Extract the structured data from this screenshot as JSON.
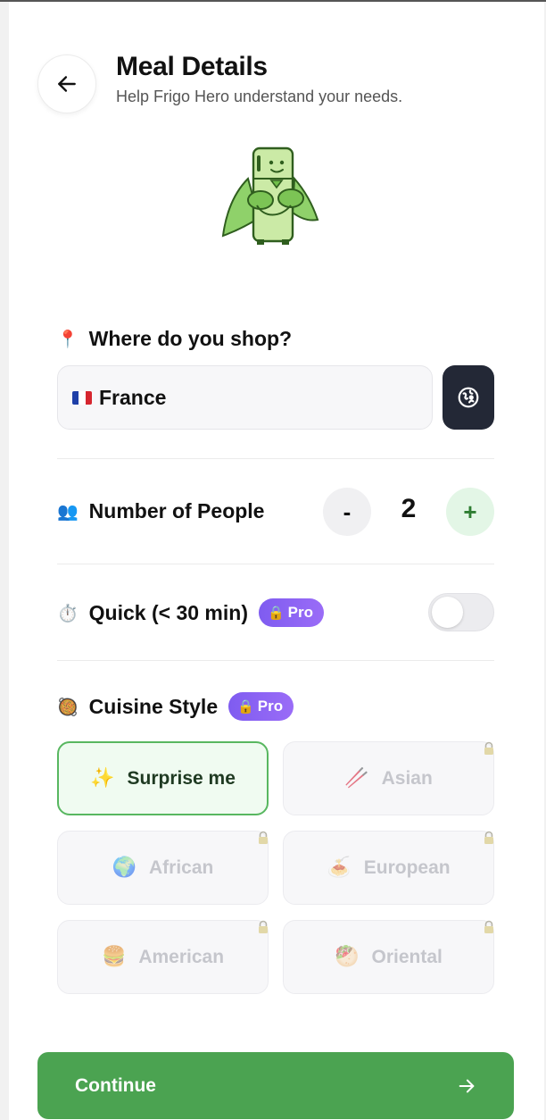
{
  "header": {
    "title": "Meal Details",
    "subtitle": "Help Frigo Hero understand your needs.",
    "back_icon": "arrow-left-icon"
  },
  "shop": {
    "label": "Where do you shop?",
    "icon": "📍",
    "country_flag": "france-flag-icon",
    "country_value": "France",
    "locate_icon": "globe-locate-icon"
  },
  "people": {
    "label": "Number of People",
    "icon": "👥",
    "minus_label": "-",
    "count": "2",
    "plus_label": "+"
  },
  "quick": {
    "label": "Quick (< 30 min)",
    "icon": "⏱️",
    "pro_label": "Pro",
    "pro_icon": "🔒",
    "enabled": false
  },
  "cuisine": {
    "label": "Cuisine Style",
    "icon": "🥘",
    "pro_label": "Pro",
    "pro_icon": "🔒",
    "options": [
      {
        "label": "Surprise me",
        "icon": "✨",
        "selected": true,
        "locked": false
      },
      {
        "label": "Asian",
        "icon": "🥢",
        "selected": false,
        "locked": true
      },
      {
        "label": "African",
        "icon": "🌍",
        "selected": false,
        "locked": true
      },
      {
        "label": "European",
        "icon": "🍝",
        "selected": false,
        "locked": true
      },
      {
        "label": "American",
        "icon": "🍔",
        "selected": false,
        "locked": true
      },
      {
        "label": "Oriental",
        "icon": "🥙",
        "selected": false,
        "locked": true
      }
    ]
  },
  "footer": {
    "continue_label": "Continue",
    "continue_icon": "arrow-right-icon"
  },
  "colors": {
    "primary_green": "#4ba351",
    "pro_purple": "#8b63f4",
    "dark_button": "#232836"
  }
}
